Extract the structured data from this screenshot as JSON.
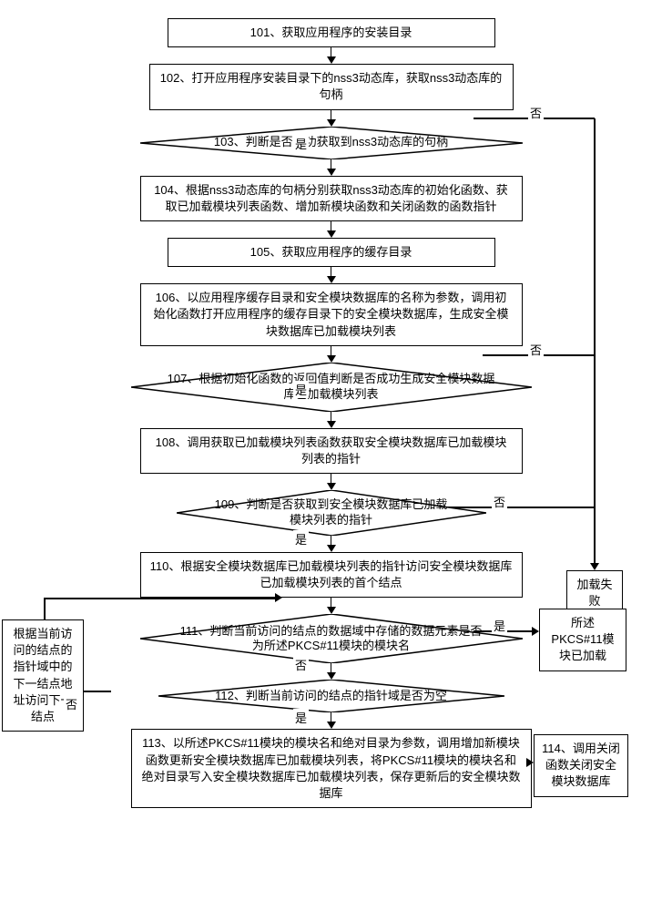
{
  "steps": {
    "s101": "101、获取应用程序的安装目录",
    "s102": "102、打开应用程序安装目录下的nss3动态库，获取nss3动态库的句柄",
    "s103": "103、判断是否成功获取到nss3动态库的句柄",
    "s104": "104、根据nss3动态库的句柄分别获取nss3动态库的初始化函数、获取已加载模块列表函数、增加新模块函数和关闭函数的函数指针",
    "s105": "105、获取应用程序的缓存目录",
    "s106": "106、以应用程序缓存目录和安全模块数据库的名称为参数，调用初始化函数打开应用程序的缓存目录下的安全模块数据库，生成安全模块数据库已加载模块列表",
    "s107": "107、根据初始化函数的返回值判断是否成功生成安全模块数据库已加载模块列表",
    "s108": "108、调用获取已加载模块列表函数获取安全模块数据库已加载模块列表的指针",
    "s109": "109、判断是否获取到安全模块数据库已加载模块列表的指针",
    "s110": "110、根据安全模块数据库已加载模块列表的指针访问安全模块数据库已加载模块列表的首个结点",
    "s111": "111、判断当前访问的结点的数据域中存储的数据元素是否为所述PKCS#11模块的模块名",
    "s112": "112、判断当前访问的结点的指针域是否为空",
    "s113": "113、以所述PKCS#11模块的模块名和绝对目录为参数，调用增加新模块函数更新安全模块数据库已加载模块列表，将PKCS#11模块的模块名和绝对目录写入安全模块数据库已加载模块列表，保存更新后的安全模块数据库",
    "s114": "114、调用关闭函数关闭安全模块数据库"
  },
  "labels": {
    "yes": "是",
    "no": "否"
  },
  "side": {
    "fail": "加载失败",
    "loaded": "所述PKCS#11模块已加载",
    "nextnode": "根据当前访问的结点的指针域中的下一结点地址访问下一结点"
  }
}
